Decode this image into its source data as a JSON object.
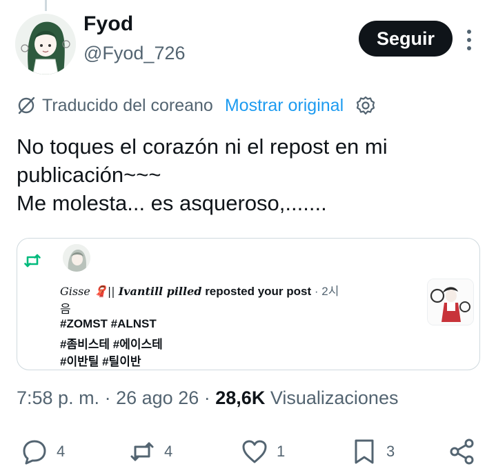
{
  "author": {
    "display_name": "Fyod",
    "handle": "@Fyod_726",
    "avatar_icon": "avatar-image"
  },
  "follow_button": {
    "label": "Seguir"
  },
  "translation": {
    "label": "Traducido del coreano",
    "show_original": "Mostrar original"
  },
  "tweet": {
    "lines": [
      "No toques el corazón ni el repost en mi",
      "publicación~~~",
      "Me molesta... es asqueroso,......."
    ]
  },
  "quoted_notification": {
    "user_name": "Gisse",
    "user_emoji": "🧣",
    "user_suffix": "||",
    "user_bold": "Ivantill pilled",
    "action": "reposted your post",
    "time": "· 2시",
    "post_lines": [
      "음",
      "#ZOMST #ALNST",
      "#좀비스테 #에이스테",
      "#이반틸 #틸이반"
    ]
  },
  "meta": {
    "time": "7:58 p. m.",
    "date": "26 ago 26",
    "separator": "·",
    "views_count": "28,6K",
    "views_label": "Visualizaciones"
  },
  "actions": {
    "replies": "4",
    "reposts": "4",
    "likes": "1",
    "bookmarks": "3"
  },
  "colors": {
    "accent": "#1d9bf0",
    "repost_green": "#00ba7c",
    "text": "#0f1419",
    "muted": "#536471",
    "border": "#cfd9de"
  }
}
